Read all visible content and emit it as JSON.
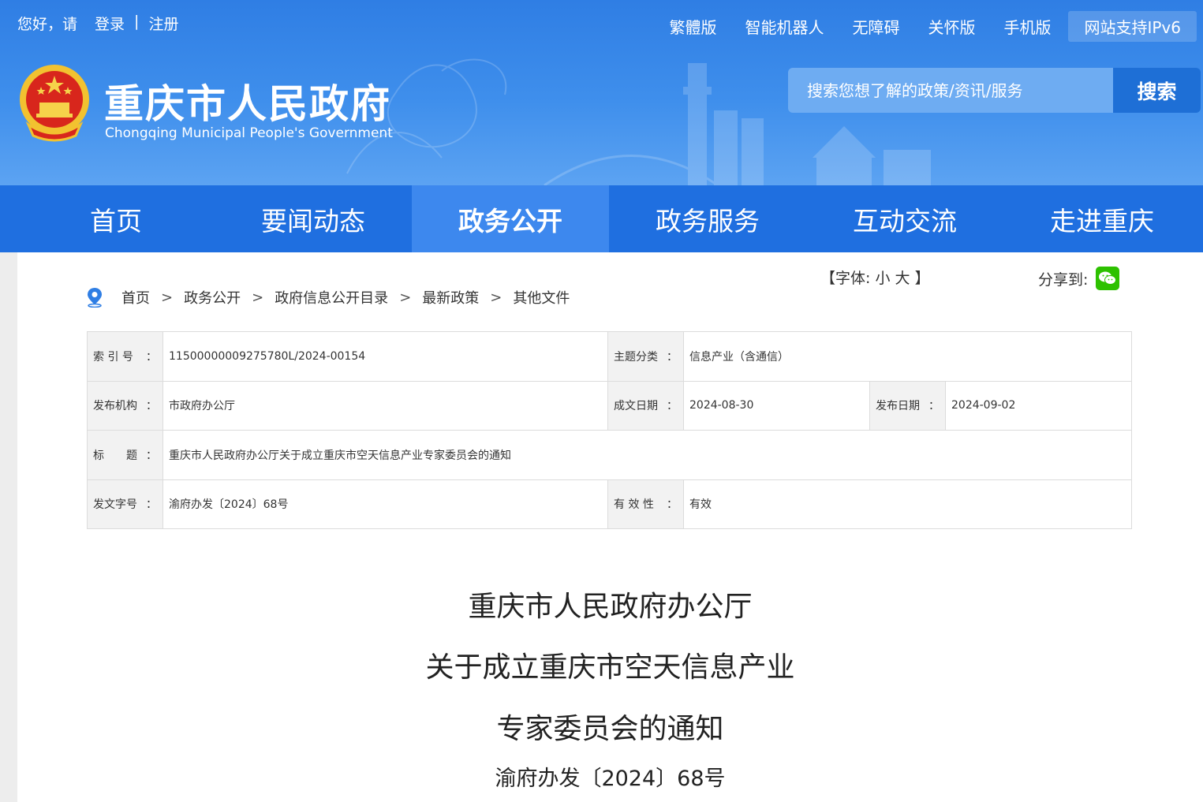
{
  "top": {
    "greeting": "您好，请",
    "login": "登录",
    "separator": "|",
    "register": "注册",
    "links": [
      "繁體版",
      "智能机器人",
      "无障碍",
      "关怀版",
      "手机版"
    ],
    "ipv6": "网站支持IPv6"
  },
  "brand": {
    "title": "重庆市人民政府",
    "subtitle": "Chongqing Municipal People's Government"
  },
  "search": {
    "placeholder": "搜索您想了解的政策/资讯/服务",
    "button": "搜索"
  },
  "nav": {
    "tabs": [
      "首页",
      "要闻动态",
      "政务公开",
      "政务服务",
      "互动交流",
      "走进重庆"
    ],
    "active": "政务公开"
  },
  "tools": {
    "font_prefix": "【字体:",
    "font_small": "小",
    "font_large": "大",
    "font_suffix": "】",
    "share_label": "分享到:"
  },
  "breadcrumb": [
    "首页",
    "政务公开",
    "政府信息公开目录",
    "最新政策",
    "其他文件"
  ],
  "meta": {
    "index_label": "索 引 号",
    "index_value": "11500000009275780L/2024-00154",
    "topic_label": "主题分类",
    "topic_value": "信息产业（含通信）",
    "issuer_label": "发布机构",
    "issuer_value": "市政府办公厅",
    "written_label": "成文日期",
    "written_value": "2024-08-30",
    "publish_label": "发布日期",
    "publish_value": "2024-09-02",
    "title_label": "标　　题",
    "title_value": "重庆市人民政府办公厅关于成立重庆市空天信息产业专家委员会的通知",
    "docno_label": "发文字号",
    "docno_value": "渝府办发〔2024〕68号",
    "valid_label": "有 效 性",
    "valid_value": "有效",
    "colon": "："
  },
  "document": {
    "title_lines": [
      "重庆市人民政府办公厅",
      "关于成立重庆市空天信息产业",
      "专家委员会的通知"
    ],
    "number": "渝府办发〔2024〕68号"
  }
}
